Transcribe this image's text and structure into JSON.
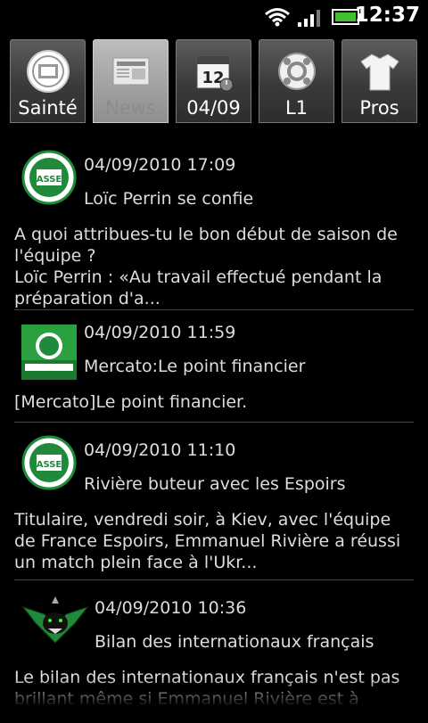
{
  "status_bar": {
    "time": "12:37",
    "icons": [
      "wifi-icon",
      "signal-icon",
      "battery-icon"
    ],
    "battery_color": "#3fc02f"
  },
  "tabs": [
    {
      "label": "Sainté",
      "icon": "asse-crest-icon",
      "selected": false
    },
    {
      "label": "News",
      "icon": "newspaper-icon",
      "selected": true
    },
    {
      "label": "04/09",
      "icon": "calendar-icon",
      "selected": false
    },
    {
      "label": "L1",
      "icon": "ligue1-ball-icon",
      "selected": false
    },
    {
      "label": "Pros",
      "icon": "jersey-icon",
      "selected": false
    }
  ],
  "news": [
    {
      "date": "04/09/2010 17:09",
      "title": "Loïc Perrin se confie",
      "summary": "A quoi attribues-tu le bon début de saison de l'équipe ?\nLoïc Perrin : «Au travail effectué pendant la préparation d'a...",
      "logo": "asse-crest-icon"
    },
    {
      "date": "04/09/2010 11:59",
      "title": "Mercato:Le point financier",
      "summary": "[Mercato]Le point financier.",
      "logo": "asse-live-logo"
    },
    {
      "date": "04/09/2010 11:10",
      "title": "Rivière buteur avec les Espoirs",
      "summary": "Titulaire, vendredi soir, à Kiev, avec l'équipe de France Espoirs, Emmanuel Rivière a réussi un match plein face à l'Ukr...",
      "logo": "asse-crest-icon"
    },
    {
      "date": "04/09/2010 10:36",
      "title": "Bilan des internationaux français",
      "summary": "Le bilan des internationaux français n'est pas brillant même si Emmanuel Rivière est à",
      "logo": "panther-logo"
    }
  ],
  "colors": {
    "background": "#000000",
    "asse_green": "#1f8a3a",
    "divider": "#444444"
  }
}
